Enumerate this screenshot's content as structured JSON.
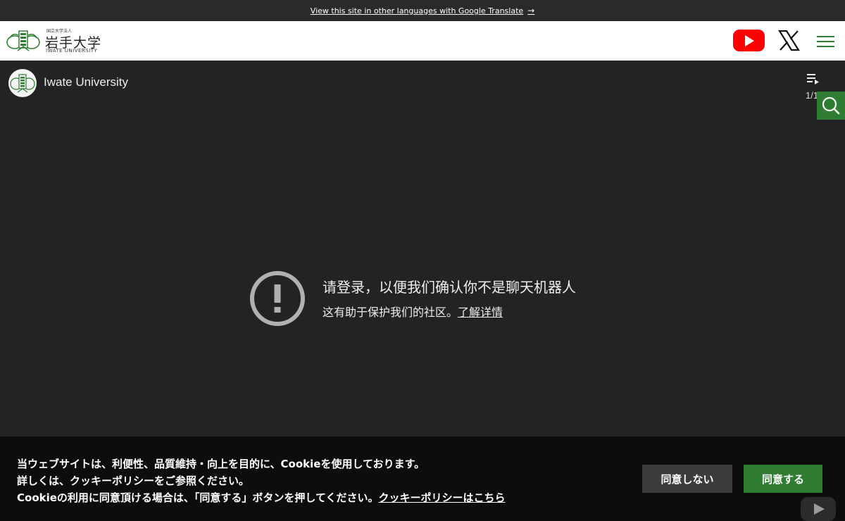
{
  "topbar": {
    "translate_link": "View this site in other languages with Google Translate",
    "arrow_icon": "arrow-right-icon"
  },
  "header": {
    "logo": {
      "small_text": "国立大学法人",
      "name_jp": "岩手大学",
      "name_en": "IWATE UNIVERSITY"
    },
    "icons": [
      "youtube-icon",
      "x-logo-icon",
      "hamburger-menu-icon"
    ],
    "accent_color": "#2e7d32",
    "youtube_color": "#ff0000"
  },
  "player": {
    "channel_name": "Iwate University",
    "playlist_count": "1/1",
    "message_title": "请登录，以便我们确认你不是聊天机器人",
    "message_sub": "这有助于保护我们的社区。",
    "learn_more": "了解详情",
    "warning_icon": "exclamation-circle-icon"
  },
  "search": {
    "icon": "search-icon"
  },
  "cookie": {
    "line1": "当ウェブサイトは、利便性、品質維持・向上を目的に、Cookieを使用しております。",
    "line2": "詳しくは、クッキーポリシーをご参照ください。",
    "line3": "Cookieの利用に同意頂ける場合は、「同意する」ボタンを押してください。",
    "policy_link": "クッキーポリシーはこちら",
    "decline_label": "同意しない",
    "accept_label": "同意する"
  }
}
